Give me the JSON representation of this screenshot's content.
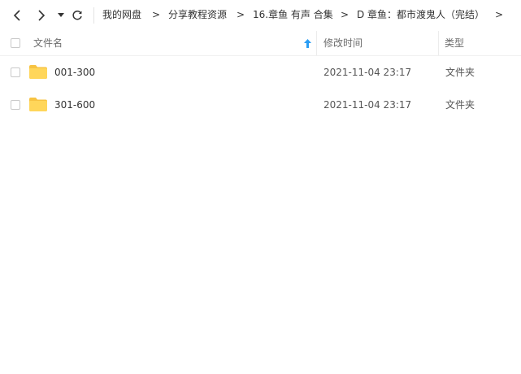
{
  "breadcrumbs": [
    "我的网盘",
    "分享教程资源",
    "16.章鱼 有声 合集",
    "D 章鱼：都市渡鬼人（完结）"
  ],
  "crumb_separator": ">",
  "columns": {
    "name": "文件名",
    "modified": "修改时间",
    "type": "类型"
  },
  "sort": {
    "column": "name",
    "direction": "ascending"
  },
  "files": [
    {
      "name": "001-300",
      "modified": "2021-11-04 23:17",
      "type": "文件夹",
      "icon": "folder-icon"
    },
    {
      "name": "301-600",
      "modified": "2021-11-04 23:17",
      "type": "文件夹",
      "icon": "folder-icon"
    }
  ],
  "colors": {
    "accent": "#2a9df4",
    "folder": "#ffd65a",
    "folder_tab": "#f7c342"
  }
}
